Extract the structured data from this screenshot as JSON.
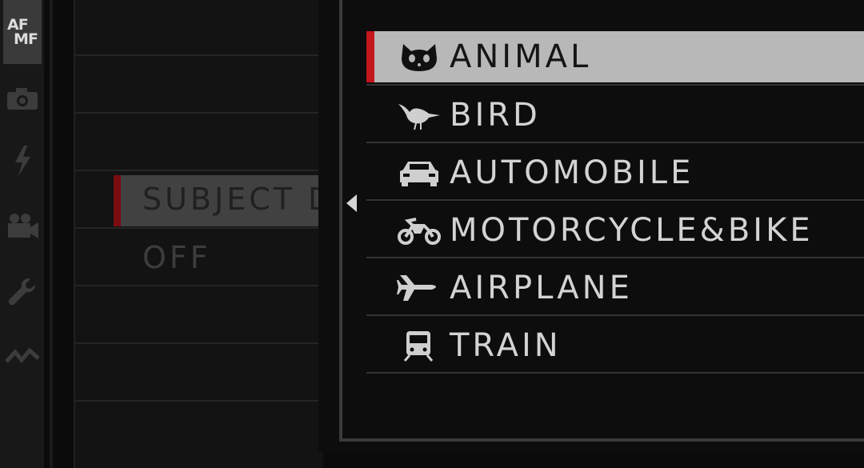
{
  "sidebar": {
    "tabs": [
      {
        "id": "af-mf",
        "label_top": "AF",
        "label_bottom": "MF",
        "icon": "af-mf-icon",
        "active": true
      },
      {
        "id": "shooting",
        "icon": "camera-icon"
      },
      {
        "id": "flash",
        "icon": "flash-icon"
      },
      {
        "id": "movie",
        "icon": "video-camera-icon"
      },
      {
        "id": "setup",
        "icon": "wrench-icon"
      },
      {
        "id": "connection",
        "icon": "connection-icon"
      }
    ]
  },
  "background_menu": {
    "selected_item": "SUBJECT D",
    "current_value": "OFF"
  },
  "popup": {
    "selected_index": 0,
    "options": [
      {
        "label": "ANIMAL",
        "icon": "cat-icon"
      },
      {
        "label": "BIRD",
        "icon": "bird-icon"
      },
      {
        "label": "AUTOMOBILE",
        "icon": "car-icon"
      },
      {
        "label": "MOTORCYCLE&BIKE",
        "icon": "motorcycle-icon"
      },
      {
        "label": "AIRPLANE",
        "icon": "airplane-icon"
      },
      {
        "label": "TRAIN",
        "icon": "train-icon"
      }
    ]
  },
  "colors": {
    "selection_bar": "#c4161c",
    "selection_bg": "#b8b8b8"
  }
}
